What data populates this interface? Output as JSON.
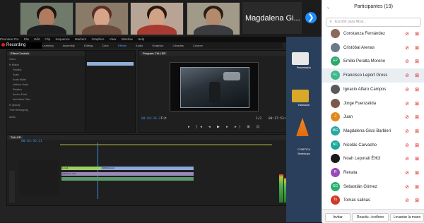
{
  "participants_panel": {
    "title": "Participantes (19)",
    "collapse_icon": "chevron-down-icon",
    "search_placeholder": "Escribir para filtrar...",
    "participants": [
      {
        "name": "Constanza Fernández",
        "initials": "",
        "color": "#8a6a5a"
      },
      {
        "name": "Cristóbal Arenas",
        "initials": "",
        "color": "#6a7a8a"
      },
      {
        "name": "Emilio Peralta Moreno",
        "initials": "EP",
        "color": "#2aa86a"
      },
      {
        "name": "Francisco Leport Gross",
        "initials": "FL",
        "color": "#3cb88a"
      },
      {
        "name": "Ignacio Alfaro Campos",
        "initials": "",
        "color": "#5a5a5a"
      },
      {
        "name": "Jorge Fuenzalida",
        "initials": "",
        "color": "#7a5a4a"
      },
      {
        "name": "Juan",
        "initials": "J",
        "color": "#e08a1e"
      },
      {
        "name": "Magdalena Gissi Barbieri",
        "initials": "MG",
        "color": "#26a7a0"
      },
      {
        "name": "Nicolás Carvacho",
        "initials": "NC",
        "color": "#16a89a"
      },
      {
        "name": "Noah Leporati ÉЖ3",
        "initials": "",
        "color": "#1a1a1a"
      },
      {
        "name": "Renata",
        "initials": "R",
        "color": "#9a4ab8"
      },
      {
        "name": "Sebastián Gómez",
        "initials": "SG",
        "color": "#2ab070"
      },
      {
        "name": "Tomas salinas",
        "initials": "Ts",
        "color": "#d03a2a"
      }
    ],
    "footer": {
      "invite": "Invitar",
      "reactivate": "Reactiv...icrófono",
      "raise_hand": "Levantar la mano"
    }
  },
  "video_strip": {
    "next_tile_name": "Magdalena Gi...",
    "next_icon": "chevron-right-icon"
  },
  "premiere": {
    "recording": "Recording",
    "menu": [
      "Premiere Pro",
      "File",
      "Edit",
      "Clip",
      "Sequence",
      "Markers",
      "Graphics",
      "View",
      "Window",
      "Help"
    ],
    "workspaces": [
      "Learning",
      "Assembly",
      "Editing",
      "Color",
      "Effects",
      "Audio",
      "Graphics",
      "Libraries",
      "Custom"
    ],
    "active_workspace": "Effects",
    "effect_controls_tab": "Effect Controls",
    "program_tab": "Program: TALLER",
    "timeline_tab": "TALLER",
    "timecode_program": "00:04:36:21",
    "timecode_duration": "00:17:53:05",
    "timecode_timeline": "00:04:36:21",
    "fit_label": "Fit",
    "quality_label": "1/2",
    "ec_rows": [
      "Video",
      "fx Motion",
      "Position",
      "Scale",
      "Scale Width",
      "Uniform Scale",
      "Rotation",
      "Anchor Point",
      "Anti-flicker Filter",
      "fx Opacity",
      "Time Remapping",
      "Audio"
    ],
    "clips": [
      "1.mp4",
      "FONDO.mp4",
      "grabacion.mp4"
    ]
  },
  "desktop": {
    "labels": [
      "Presentación",
      "Instalación",
      "CYNETICA",
      "Workshops"
    ]
  }
}
